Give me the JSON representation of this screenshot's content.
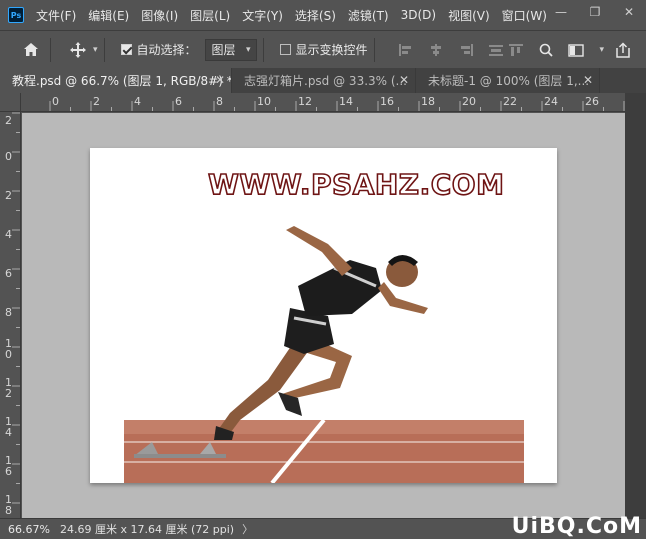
{
  "app": {
    "logo": "Ps"
  },
  "menu": [
    "文件(F)",
    "编辑(E)",
    "图像(I)",
    "图层(L)",
    "文字(Y)",
    "选择(S)",
    "滤镜(T)",
    "3D(D)",
    "视图(V)",
    "窗口(W)"
  ],
  "window_controls": {
    "minimize": "—",
    "restore": "❐",
    "close": "✕"
  },
  "options": {
    "auto_select_label": "自动选择：",
    "auto_select_checked": true,
    "auto_select_target": "图层",
    "show_transform_label": "显示变换控件",
    "show_transform_checked": false
  },
  "tabs": [
    {
      "label": "教程.psd @ 66.7% (图层 1, RGB/8#) *",
      "active": true
    },
    {
      "label": "志强灯箱片.psd @ 33.3% (...",
      "active": false
    },
    {
      "label": "未标题-1 @ 100% (图层 1,...",
      "active": false
    }
  ],
  "ruler_top_labels": [
    "2",
    "0",
    "2",
    "4",
    "6",
    "8",
    "10",
    "12",
    "14",
    "16",
    "18",
    "20",
    "22",
    "24",
    "26"
  ],
  "ruler_left_labels": [
    "2",
    "0",
    "2",
    "4",
    "6",
    "8",
    "1\n0",
    "1\n2",
    "1\n4",
    "1\n6",
    "1\n8"
  ],
  "canvas": {
    "title_text": "WWW.PSAHZ.COM",
    "title_stroke_color": "#6e1414",
    "track_color": "#b06a55"
  },
  "status": {
    "zoom": "66.67%",
    "doc_info": "24.69 厘米 x 17.64 厘米 (72 ppi)",
    "arrow": "〉"
  },
  "site_watermark": "UiBQ.CoM"
}
